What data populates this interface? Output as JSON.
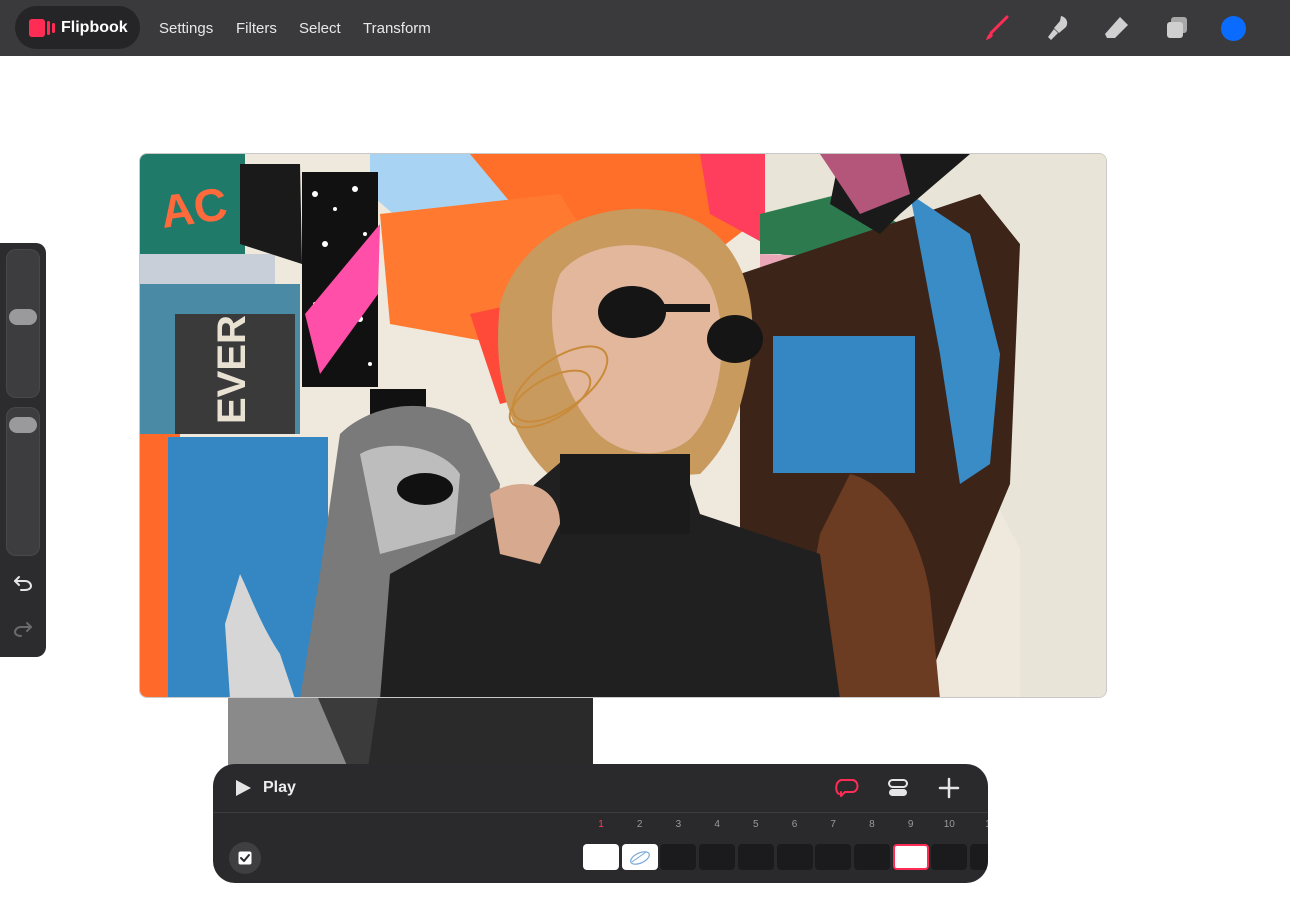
{
  "app": {
    "name": "Flipbook",
    "accent": "#ff2d55"
  },
  "menu": [
    {
      "label": "Settings"
    },
    {
      "label": "Filters"
    },
    {
      "label": "Select"
    },
    {
      "label": "Transform"
    }
  ],
  "tools": {
    "icons": [
      "brush-icon",
      "smudge-icon",
      "eraser-icon",
      "layers-icon"
    ],
    "active_tool": "brush-icon",
    "current_color": "#0a6cff"
  },
  "sidebar": {
    "size_slider_value": 0.55,
    "opacity_slider_value": 0.95,
    "undo_icon": "undo-icon",
    "redo_icon": "redo-icon"
  },
  "timeline": {
    "play_label": "Play",
    "loop_icon": "loop-icon",
    "settings_icon": "timeline-settings-icon",
    "add_icon": "plus-icon",
    "onion_skin_enabled": true,
    "frames": [
      "1",
      "2",
      "3",
      "4",
      "5",
      "6",
      "7",
      "8",
      "9",
      "10",
      "1"
    ],
    "current_frame": "1",
    "selected_frame": "9",
    "filled_frames": [
      "1",
      "2",
      "9"
    ]
  }
}
